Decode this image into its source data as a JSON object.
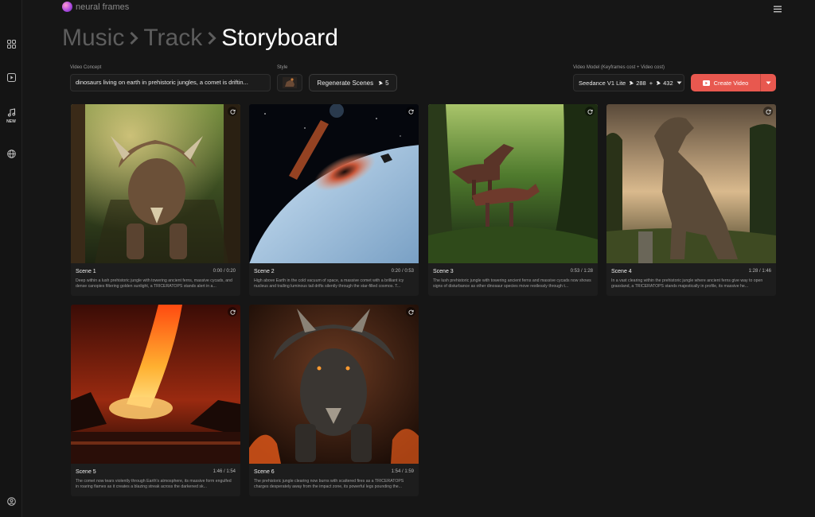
{
  "app": {
    "name": "neural frames"
  },
  "sidebar": {
    "items": [
      {
        "icon": "grid-icon"
      },
      {
        "icon": "play-square-icon"
      },
      {
        "icon": "music-note-icon",
        "badge": "NEW"
      },
      {
        "icon": "globe-icon"
      }
    ],
    "bottom_icon": "user-circle-icon"
  },
  "breadcrumb": {
    "items": [
      "Music",
      "Track",
      "Storyboard"
    ]
  },
  "controls": {
    "concept_label": "Video Concept",
    "concept_value": "dinosaurs living on earth in prehistoric jungles, a comet is driftin...",
    "style_label": "Style",
    "regenerate_label": "Regenerate Scenes",
    "regenerate_cost": "5",
    "model_label": "Video Model (Keyframes cost + Video cost)",
    "model_value": "Seedance V1 Lite",
    "model_keyframe_cost": "288",
    "model_plus": "+",
    "model_video_cost": "432",
    "create_label": "Create Video"
  },
  "colors": {
    "accent": "#e8584f",
    "background": "#161616",
    "card": "#1d1d1d"
  },
  "scenes": [
    {
      "title": "Scene 1",
      "time": "0:00 / 0:20",
      "desc": "Deep within a lush prehistoric jungle with towering ancient ferns, massive cycads, and dense canopies filtering golden sunlight, a TRICERATOPS stands alert in a..."
    },
    {
      "title": "Scene 2",
      "time": "0:20 / 0:53",
      "desc": "High above Earth in the cold vacuum of space, a massive comet with a brilliant icy nucleus and trailing luminous tail drifts silently through the star-filled cosmos. T..."
    },
    {
      "title": "Scene 3",
      "time": "0:53 / 1:28",
      "desc": "The lush prehistoric jungle with towering ancient ferns and massive cycads now shows signs of disturbance as other dinosaur species move restlessly through t..."
    },
    {
      "title": "Scene 4",
      "time": "1:28 / 1:46",
      "desc": "In a vast clearing within the prehistoric jungle where ancient ferns give way to open grassland, a TRICERATOPS stands majestically in profile, its massive he..."
    },
    {
      "title": "Scene 5",
      "time": "1:46 / 1:54",
      "desc": "The comet now tears violently through Earth's atmosphere, its massive form engulfed in roaring flames as it creates a blazing streak across the darkened sk..."
    },
    {
      "title": "Scene 6",
      "time": "1:54 / 1:59",
      "desc": "The prehistoric jungle clearing now burns with scattered fires as a TRICERATOPS charges desperately away from the impact zone, its powerful legs pounding the..."
    }
  ]
}
